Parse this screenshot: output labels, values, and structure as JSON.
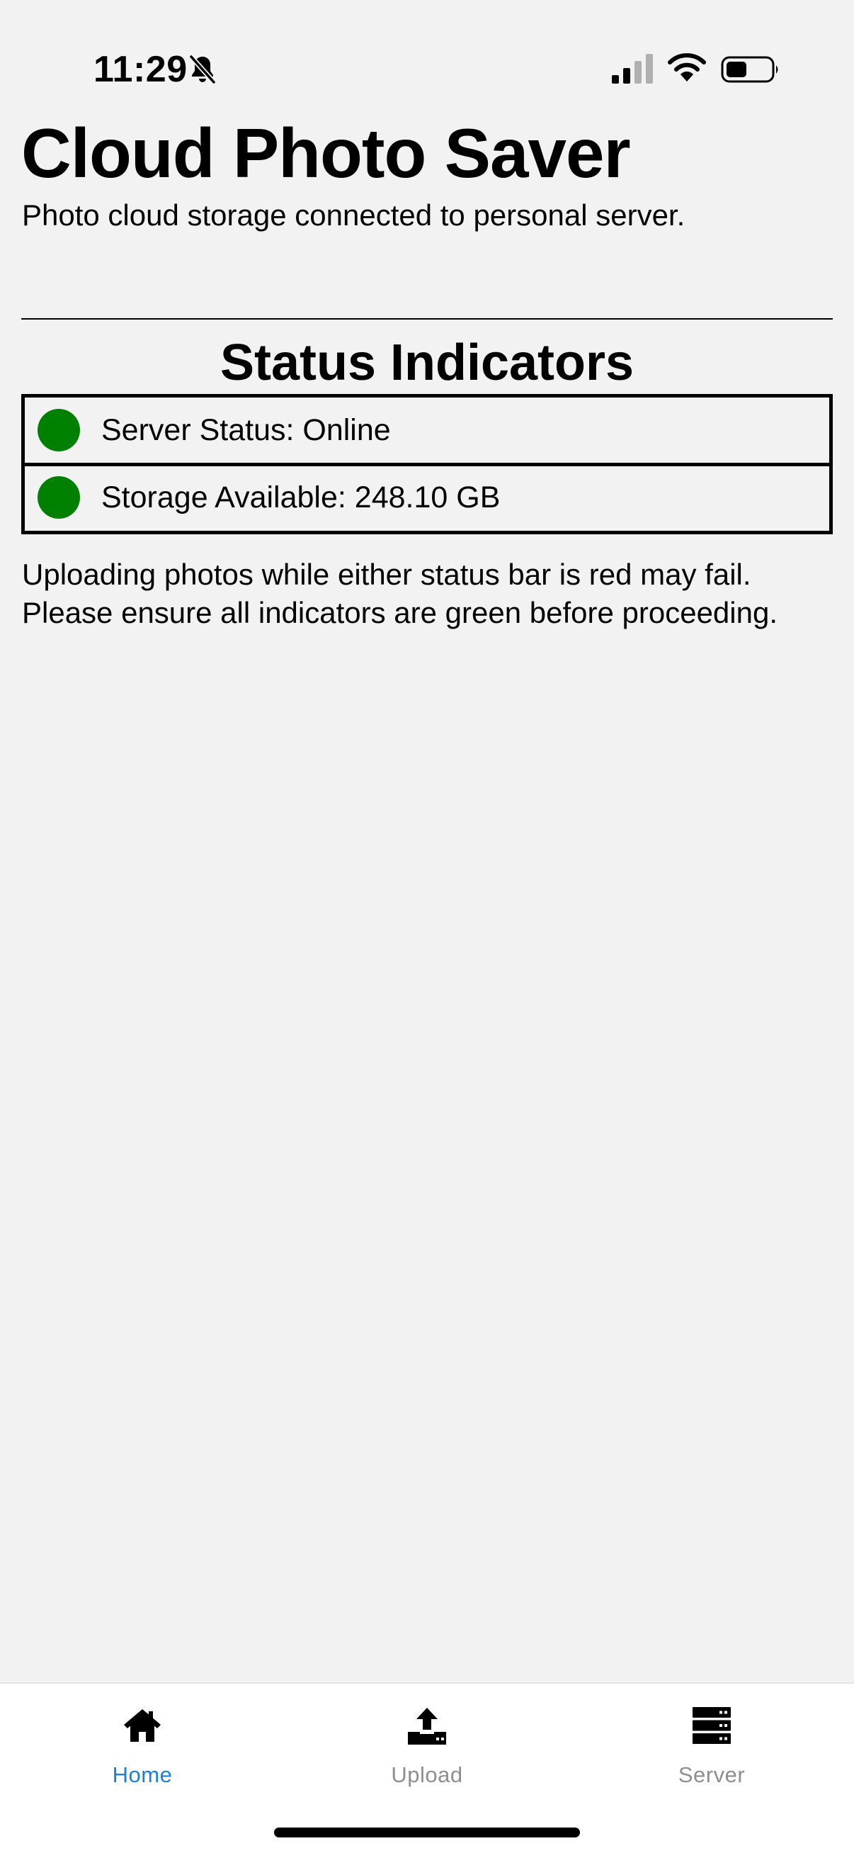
{
  "status_bar": {
    "time": "11:29",
    "icons": [
      "bell-slash-icon",
      "cellular-signal-icon",
      "wifi-icon",
      "battery-icon"
    ]
  },
  "header": {
    "title": "Cloud Photo Saver",
    "subtitle": "Photo cloud storage connected to personal server."
  },
  "status_section": {
    "title": "Status Indicators",
    "items": [
      {
        "label": "Server Status: Online",
        "color": "#008000"
      },
      {
        "label": "Storage Available: 248.10 GB",
        "color": "#008000"
      }
    ],
    "warning": "Uploading photos while either status bar is red may fail. Please ensure all indicators are green before proceeding."
  },
  "tab_bar": {
    "tabs": [
      {
        "label": "Home",
        "icon": "home-icon",
        "active": true
      },
      {
        "label": "Upload",
        "icon": "upload-icon",
        "active": false
      },
      {
        "label": "Server",
        "icon": "server-icon",
        "active": false
      }
    ]
  },
  "colors": {
    "background": "#f2f2f2",
    "tab_active": "#1a7fe0",
    "tab_inactive": "#8e8e8e",
    "status_ok": "#008000"
  }
}
